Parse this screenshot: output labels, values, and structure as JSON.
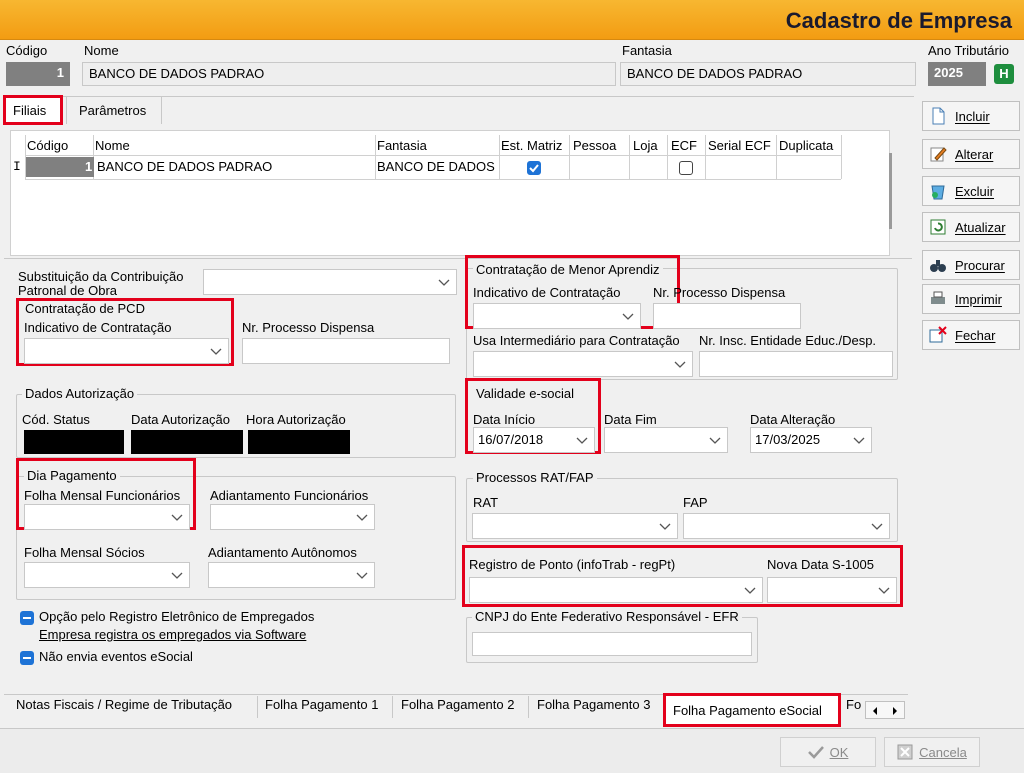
{
  "window": {
    "title": "Cadastro de Empresa"
  },
  "header": {
    "codigo_label": "Código",
    "codigo_value": "1",
    "nome_label": "Nome",
    "nome_value": "BANCO DE DADOS PADRAO",
    "fantasia_label": "Fantasia",
    "fantasia_value": "BANCO DE DADOS PADRAO",
    "ano_label": "Ano Tributário",
    "ano_value": "2025",
    "ano_badge": "H"
  },
  "top_tabs": [
    "Filiais",
    "Parâmetros"
  ],
  "grid": {
    "columns": [
      "Código",
      "Nome",
      "Fantasia",
      "Est. Matriz",
      "Pessoa",
      "Loja",
      "ECF",
      "Serial ECF",
      "Duplicata"
    ],
    "row_marker": "I",
    "rows": [
      {
        "codigo": "1",
        "nome": "BANCO DE DADOS PADRAO",
        "fantasia": "BANCO DE DADOS PADRAO",
        "est_matriz": true,
        "ecf": false
      }
    ]
  },
  "side_buttons": [
    "Incluir",
    "Alterar",
    "Excluir",
    "Atualizar",
    "Procurar",
    "Imprimir",
    "Fechar"
  ],
  "form": {
    "substituicao_label": "Substituição da Contribuição Patronal de Obra",
    "pcd": {
      "title": "Contratação de PCD",
      "indicativo_label": "Indicativo de Contratação",
      "processo_label": "Nr. Processo Dispensa"
    },
    "menor_aprendiz": {
      "title": "Contratação de Menor Aprendiz",
      "indicativo_label": "Indicativo de Contratação",
      "processo_label": "Nr. Processo Dispensa"
    },
    "intermediario_label": "Usa Intermediário para Contratação",
    "insc_entidade_label": "Nr. Insc. Entidade Educ./Desp.",
    "autorizacao": {
      "title": "Dados Autorização",
      "cod_status": "Cód. Status",
      "data": "Data Autorização",
      "hora": "Hora Autorização"
    },
    "validade": {
      "title": "Validade e-social",
      "inicio_label": "Data Início",
      "inicio_value": "16/07/2018",
      "fim_label": "Data Fim"
    },
    "alteracao": {
      "label": "Data Alteração",
      "value": "17/03/2025"
    },
    "dia_pagamento": {
      "title": "Dia Pagamento",
      "folha_func": "Folha Mensal Funcionários",
      "adiant_func": "Adiantamento Funcionários",
      "folha_socios": "Folha Mensal Sócios",
      "adiant_auto": "Adiantamento Autônomos"
    },
    "rat_fap": {
      "title": "Processos RAT/FAP",
      "rat": "RAT",
      "fap": "FAP"
    },
    "registro_ponto_label": "Registro de Ponto (infoTrab - regPt)",
    "nova_data_label": "Nova Data S-1005",
    "efr_title": "CNPJ do Ente Federativo Responsável - EFR",
    "opcao_registro": "Opção pelo Registro Eletrônico de Empregados",
    "empresa_registra": "Empresa registra os empregados via Software",
    "nao_envia": "Não envia eventos eSocial"
  },
  "bottom_tabs": [
    "Notas Fiscais / Regime de Tributação",
    "Folha Pagamento 1",
    "Folha Pagamento 2",
    "Folha Pagamento 3",
    "Folha Pagamento eSocial",
    "Fo"
  ],
  "footer": {
    "ok": "OK",
    "cancel": "Cancela"
  },
  "colors": {
    "titlebar": "#f39c12",
    "highlight": "#e3001b",
    "check": "#1e73d6"
  }
}
